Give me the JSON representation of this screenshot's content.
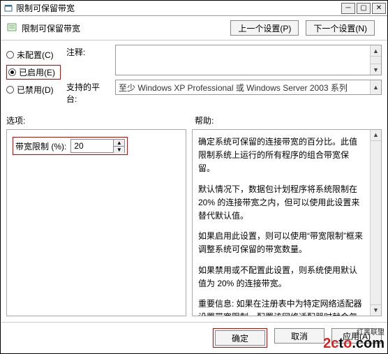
{
  "window": {
    "title": "限制可保留带宽"
  },
  "toolbar": {
    "label": "限制可保留带宽",
    "prev": "上一个设置(P)",
    "next": "下一个设置(N)"
  },
  "radios": {
    "not_configured": "未配置(C)",
    "enabled": "已启用(E)",
    "disabled": "已禁用(D)"
  },
  "fields": {
    "comment_label": "注释:",
    "platform_label": "支持的平台:",
    "platform_value": "至少 Windows XP Professional 或 Windows Server 2003 系列"
  },
  "section_labels": {
    "options": "选项:",
    "help": "帮助:"
  },
  "option": {
    "label": "带宽限制 (%):",
    "value": "20"
  },
  "help": {
    "p1": "确定系统可保留的连接带宽的百分比。此值限制系统上运行的所有程序的组合带宽保留。",
    "p2": "默认情况下，数据包计划程序将系统限制在 20% 的连接带宽之内，但可以使用此设置来替代默认值。",
    "p3": "如果启用此设置，则可以使用“带宽限制”框来调整系统可保留的带宽数量。",
    "p4": "如果禁用或不配置此设置，则系统使用默认值为 20% 的连接带宽。",
    "p5": "重要信息: 如果在注册表中为特定网络适配器设置带宽限制，配置该网络适配器时就会忽略此设置。"
  },
  "footer": {
    "ok": "确定",
    "cancel": "取消",
    "apply": "应用(A)"
  },
  "watermark": {
    "top": "红黑联盟",
    "text1": "2c",
    "text2": "t",
    "text3": "o",
    "text4": ".com"
  }
}
